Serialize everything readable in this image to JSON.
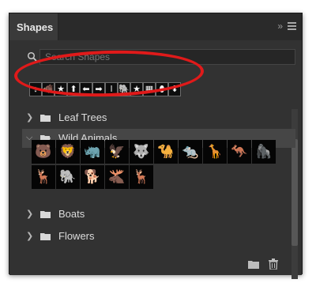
{
  "panel": {
    "tab_title": "Shapes",
    "collapse_glyph": "»"
  },
  "search": {
    "placeholder": "Search Shapes"
  },
  "recent_shapes": {
    "icons": [
      "↓",
      "🐗",
      "★",
      "⬆",
      "⬅",
      "➡",
      "ǀ",
      "🐘",
      "★",
      "▦",
      "⬮",
      "⬇"
    ]
  },
  "groups": [
    {
      "label": "Leaf Trees",
      "expanded": false
    },
    {
      "label": "Wild Animals",
      "expanded": true
    },
    {
      "label": "Boats",
      "expanded": false
    },
    {
      "label": "Flowers",
      "expanded": false
    }
  ],
  "wild_animals": {
    "row1": [
      "bear-icon",
      "lion-icon",
      "rhino-icon",
      "bird-icon",
      "wolf-icon",
      "camel-icon",
      "rat-icon",
      "giraffe-icon",
      "kangaroo-icon",
      "gorilla-icon"
    ],
    "row2": [
      "deer-icon",
      "elephant-icon",
      "coyote-icon",
      "moose-icon",
      "reindeer-icon"
    ]
  },
  "colors": {
    "panel_bg": "#323232",
    "highlight_ring": "#e01a1a",
    "selected_row": "#464646"
  }
}
